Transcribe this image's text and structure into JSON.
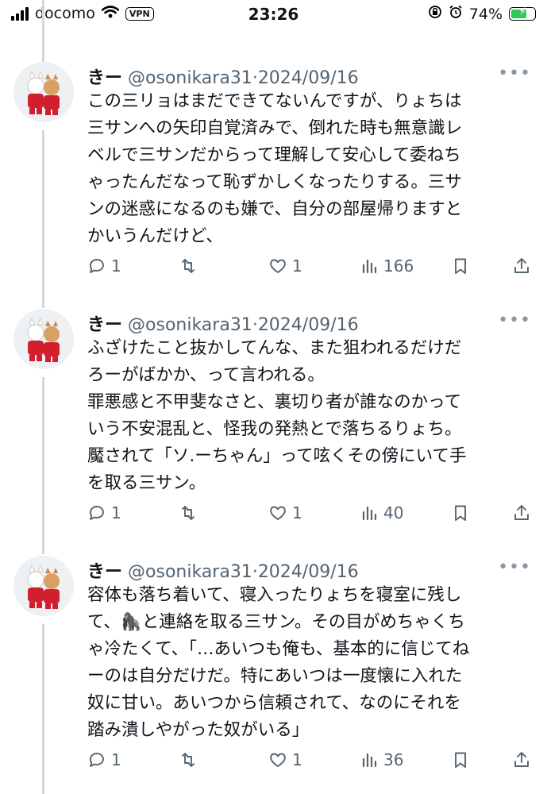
{
  "status_bar": {
    "carrier": "docomo",
    "vpn_label": "VPN",
    "time": "23:26",
    "battery_percent": "74%",
    "battery_level": 0.74,
    "battery_color": "#34c759"
  },
  "tweets": [
    {
      "name": "きー",
      "handle": "@osonikara31",
      "separator": "·",
      "date": "2024/09/16",
      "text": "この三リョはまだできてないんですが、りょちは\n三サンへの矢印自覚済みで、倒れた時も無意識レ\nベルで三サンだからって理解して安心して委ねち\nゃったんだなって恥ずかしくなったりする。三サ\nンの迷惑になるのも嫌で、自分の部屋帰りますと\nかいうんだけど、",
      "replies": "1",
      "retweets": "",
      "likes": "1",
      "views": "166"
    },
    {
      "name": "きー",
      "handle": "@osonikara31",
      "separator": "·",
      "date": "2024/09/16",
      "text": "ふざけたこと抜かしてんな、また狙われるだけだ\nろーがばかか、って言われる。\n罪悪感と不甲斐なさと、裏切り者が誰なのかって\nいう不安混乱と、怪我の発熱とで落ちるりょち。\n魘されて「ソ.ーちゃん」って呟くその傍にいて手\nを取る三サン。",
      "replies": "1",
      "retweets": "",
      "likes": "1",
      "views": "40"
    },
    {
      "name": "きー",
      "handle": "@osonikara31",
      "separator": "·",
      "date": "2024/09/16",
      "text": "容体も落ち着いて、寝入ったりょちを寝室に残し\nて、🦍と連絡を取る三サン。その目がめちゃくち\nゃ冷たくて、「…あいつも俺も、基本的に信じてね\nーのは自分だけだ。特にあいつは一度懐に入れた\n奴に甘い。あいつから信頼されて、なのにそれを\n踏み潰しやがった奴がいる」",
      "replies": "1",
      "retweets": "",
      "likes": "1",
      "views": "36"
    }
  ],
  "icons": {
    "reply": "reply-icon",
    "retweet": "retweet-icon",
    "like": "heart-icon",
    "views": "views-chart-icon",
    "bookmark": "bookmark-icon",
    "share": "share-icon",
    "more": "more-dots-icon"
  },
  "colors": {
    "text": "#0f1419",
    "secondary": "#536471",
    "thread_line": "#cfd9de"
  }
}
